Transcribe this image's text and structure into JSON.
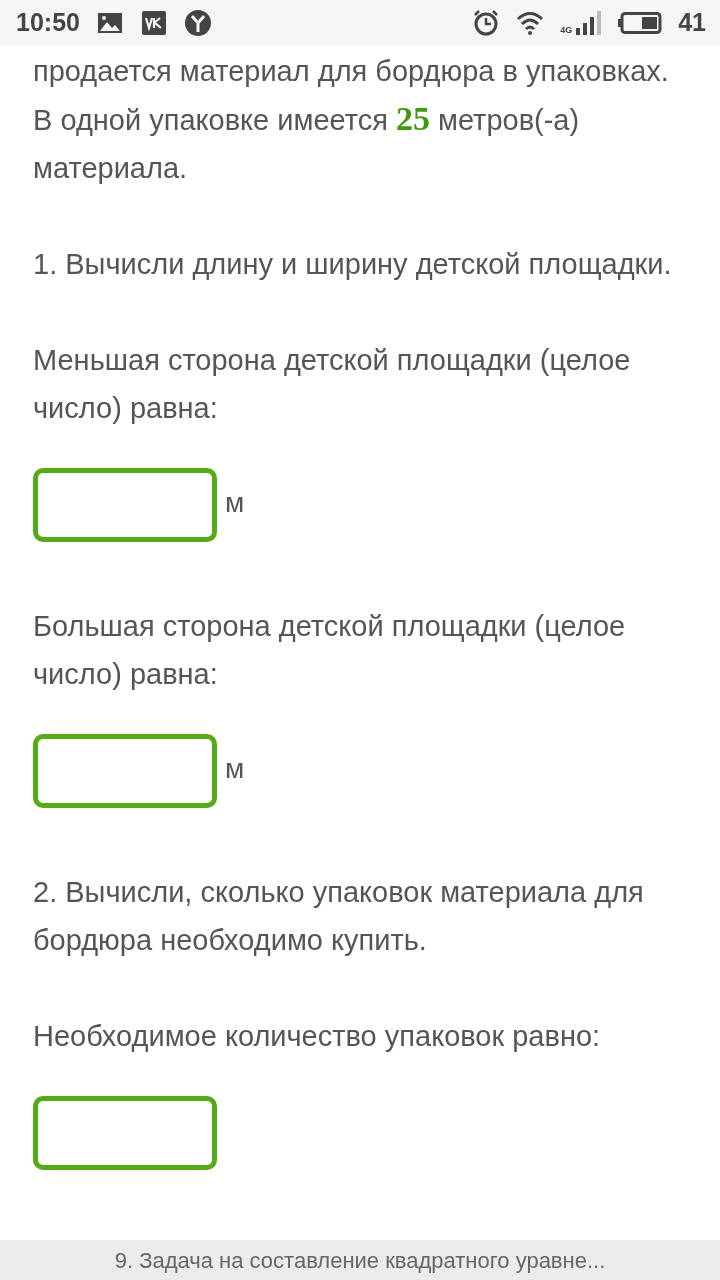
{
  "status_bar": {
    "time": "10:50",
    "network": "4G",
    "battery": "41"
  },
  "content": [
    {
      "kind": "paragraph",
      "text": "продается материал для бордюра в упаковках. В одной упаковке имеется **25** метров(-а) материала."
    },
    {
      "kind": "paragraph",
      "text": "1. Вычисли длину и ширину детской площадки."
    },
    {
      "kind": "paragraph",
      "text": "Меньшая сторона детской площадки (целое число) равна:"
    },
    {
      "kind": "answer",
      "unit": "м"
    },
    {
      "kind": "paragraph",
      "text": "Большая сторона детской площадки (целое число) равна:"
    },
    {
      "kind": "answer",
      "unit": "м"
    },
    {
      "kind": "paragraph",
      "text": "2. Вычисли, сколько упаковок материала для бордюра необходимо купить."
    },
    {
      "kind": "paragraph",
      "text": "Необходимое количество упаковок равно:"
    },
    {
      "kind": "answer"
    }
  ],
  "footer": {
    "title": "9. Задача на составление квадратного уравне..."
  }
}
